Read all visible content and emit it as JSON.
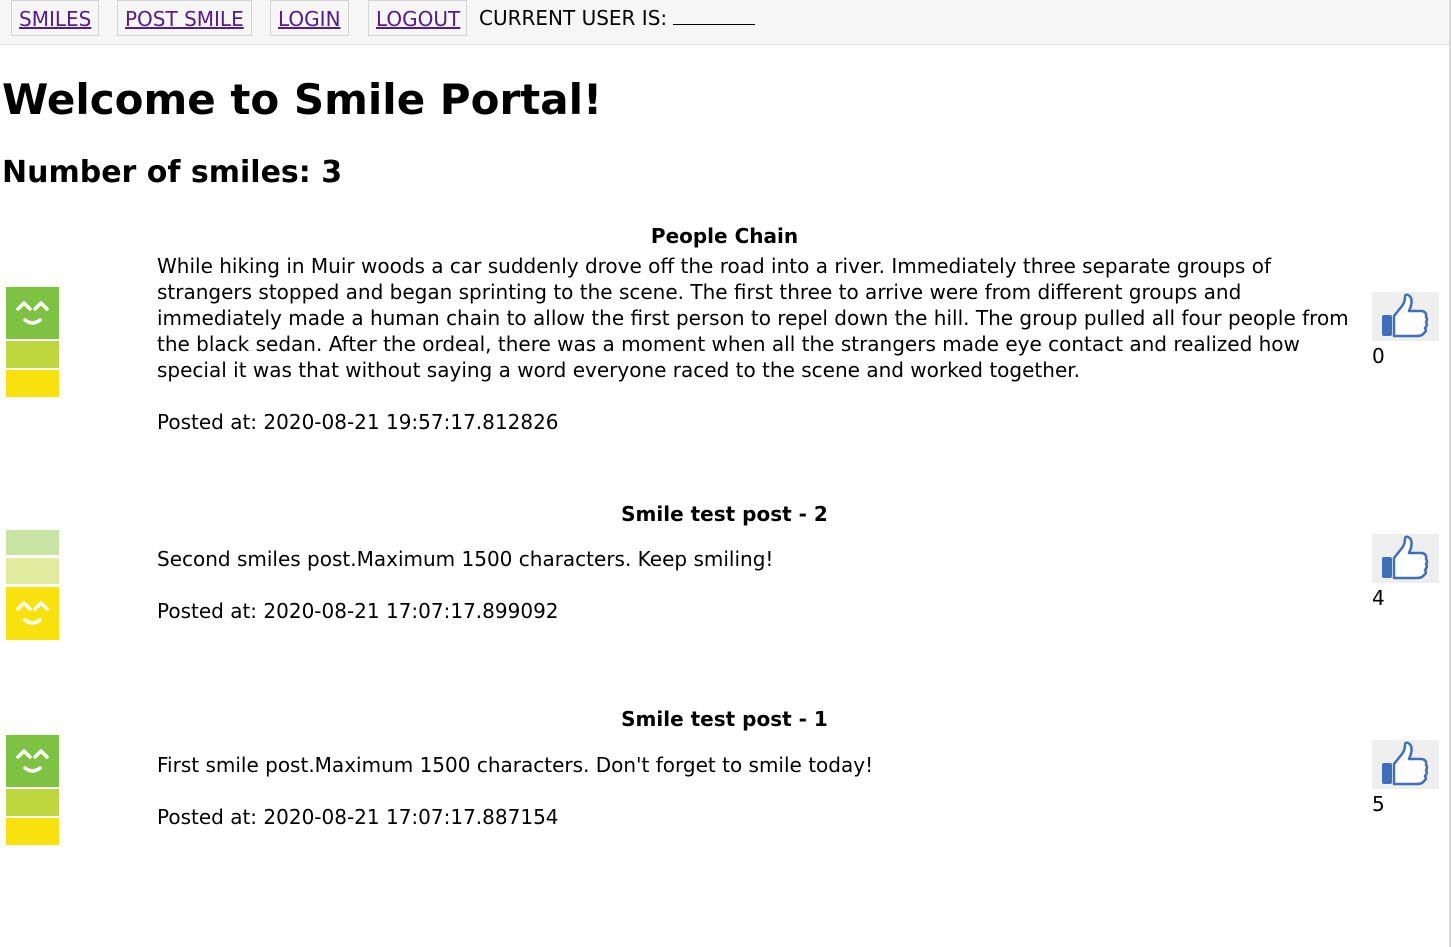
{
  "nav": {
    "links": [
      {
        "label": "SMILES"
      },
      {
        "label": "POST SMILE"
      },
      {
        "label": "LOGIN"
      },
      {
        "label": "LOGOUT"
      }
    ],
    "current_user_label": "CURRENT USER IS:"
  },
  "main": {
    "title": "Welcome to Smile Portal!",
    "count_text": "Number of smiles: 3"
  },
  "posts": [
    {
      "title": "People Chain",
      "body": "While hiking in Muir woods a car suddenly drove off the road into a river. Immediately three separate groups of strangers stopped and began sprinting to the scene. The first three to arrive were from different groups and immediately made a human chain to allow the first person to repel down the hill. The group pulled all four people from the black sedan. After the ordeal, there was a moment when all the strangers made eye contact and realized how special it was that without saying a word everyone raced to the scene and worked together.",
      "posted_at": "Posted at: 2020-08-21 19:57:17.812826",
      "likes": "0",
      "smiley_level": "top"
    },
    {
      "title": "Smile test post - 2",
      "body": "Second smiles post.Maximum 1500 characters. Keep smiling!",
      "posted_at": "Posted at: 2020-08-21 17:07:17.899092",
      "likes": "4",
      "smiley_level": "bottom"
    },
    {
      "title": "Smile test post - 1",
      "body": "First smile post.Maximum 1500 characters. Don't forget to smile today!",
      "posted_at": "Posted at: 2020-08-21 17:07:17.887154",
      "likes": "5",
      "smiley_level": "top"
    }
  ],
  "colors": {
    "visited_link": "#551a8b",
    "smiley_green": "#7dc242",
    "smiley_lime": "#bdd63d",
    "smiley_yellow": "#f9e10d",
    "smiley_pale_green": "#c8e3a2",
    "smiley_pale_yellow": "#e2eca0",
    "like_blue": "#3e6fb8"
  },
  "icons": {
    "like": "thumbs-up-icon",
    "smiley": "smiley-meter-icon"
  }
}
